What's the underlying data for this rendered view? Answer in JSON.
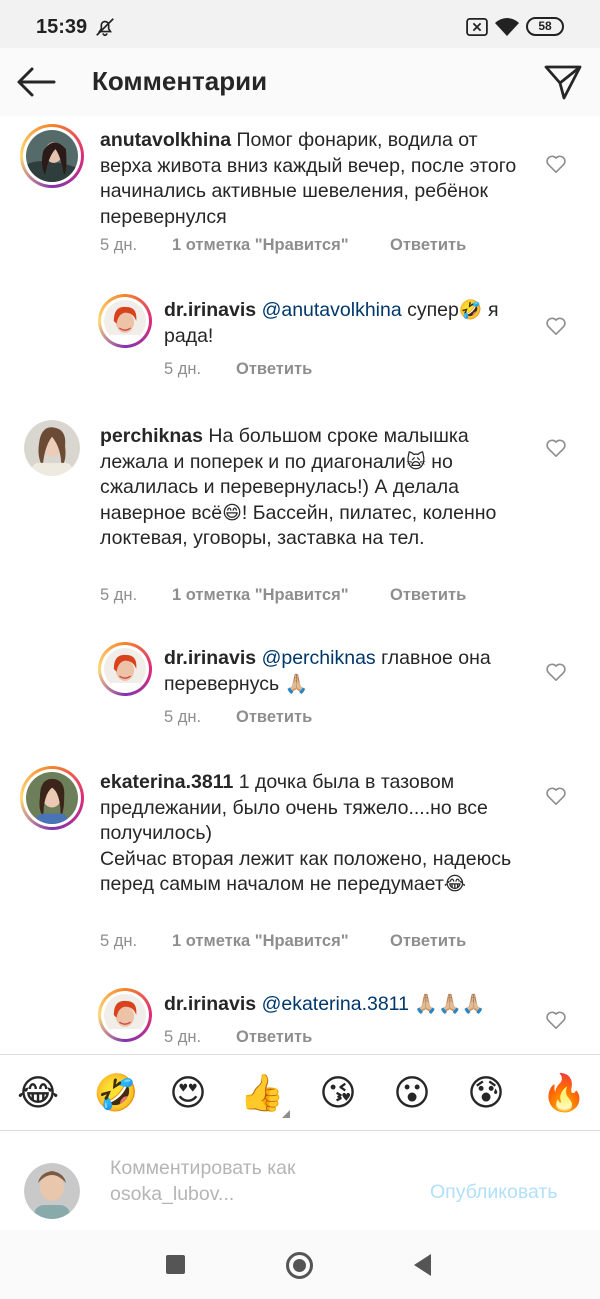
{
  "status_bar": {
    "time": "15:39",
    "battery": "58"
  },
  "header": {
    "title": "Комментарии"
  },
  "comments": [
    {
      "user": "anutavolkhina",
      "segments": [
        {
          "text": " Помог фонарик, водила от верха живота вниз каждый вечер, после этого начинались активные шевеления, ребёнок перевернулся"
        }
      ],
      "time": "5 дн.",
      "likes": "1 отметка \"Нравится\"",
      "reply": "Ответить"
    },
    {
      "user": "dr.irinavis",
      "mention": "@anutavolkhina",
      "segments": [
        {
          "text": " супер"
        },
        {
          "emoji": "🤣"
        },
        {
          "text": " я рада!"
        }
      ],
      "time": "5 дн.",
      "reply": "Ответить"
    },
    {
      "user": "perchiknas",
      "segments": [
        {
          "text": " На большом сроке малышка лежала и поперек и по диагонали"
        },
        {
          "emoji": "🙀"
        },
        {
          "text": " но сжалилась и перевернулась!) А делала наверное всё"
        },
        {
          "emoji": "😄"
        },
        {
          "text": "! Бассейн, пилатес, коленно локтевая, уговоры, заставка на тел."
        }
      ],
      "time": "5 дн.",
      "likes": "1 отметка \"Нравится\"",
      "reply": "Ответить"
    },
    {
      "user": "dr.irinavis",
      "mention": "@perchiknas",
      "segments": [
        {
          "text": " главное она перевернусь "
        },
        {
          "emoji": "🙏🏼"
        }
      ],
      "time": "5 дн.",
      "reply": "Ответить"
    },
    {
      "user": "ekaterina.3811",
      "segments": [
        {
          "text": " 1 дочка была в тазовом предлежании, было очень тяжело....но все получилось) Сейчас вторая лежит как положено, надеюсь перед самым началом не передумает"
        },
        {
          "emoji": "😂"
        }
      ],
      "time": "5 дн.",
      "likes": "1 отметка \"Нравится\"",
      "reply": "Ответить"
    },
    {
      "user": "dr.irinavis",
      "mention": "@ekaterina.3811",
      "segments": [
        {
          "text": " "
        },
        {
          "emoji": "🙏🏼🙏🏼🙏🏼"
        }
      ],
      "time": "5 дн.",
      "reply": "Ответить"
    }
  ],
  "emoji_bar": [
    "😂",
    "🤣",
    "😍",
    "👍",
    "😘",
    "😮",
    "😰",
    "🔥"
  ],
  "compose": {
    "placeholder_line1": "Комментировать как",
    "placeholder_line2": "osoka_lubov...",
    "publish": "Опубликовать"
  },
  "icons": {
    "back": "arrow-left-icon",
    "send": "paper-plane-icon",
    "heart": "heart-outline-icon",
    "mute": "bell-off-icon",
    "wifi": "wifi-icon",
    "battery": "battery-icon"
  },
  "colors": {
    "mention": "#00376b",
    "meta": "#8e8e8e",
    "publish_disabled": "#b2dffc"
  }
}
